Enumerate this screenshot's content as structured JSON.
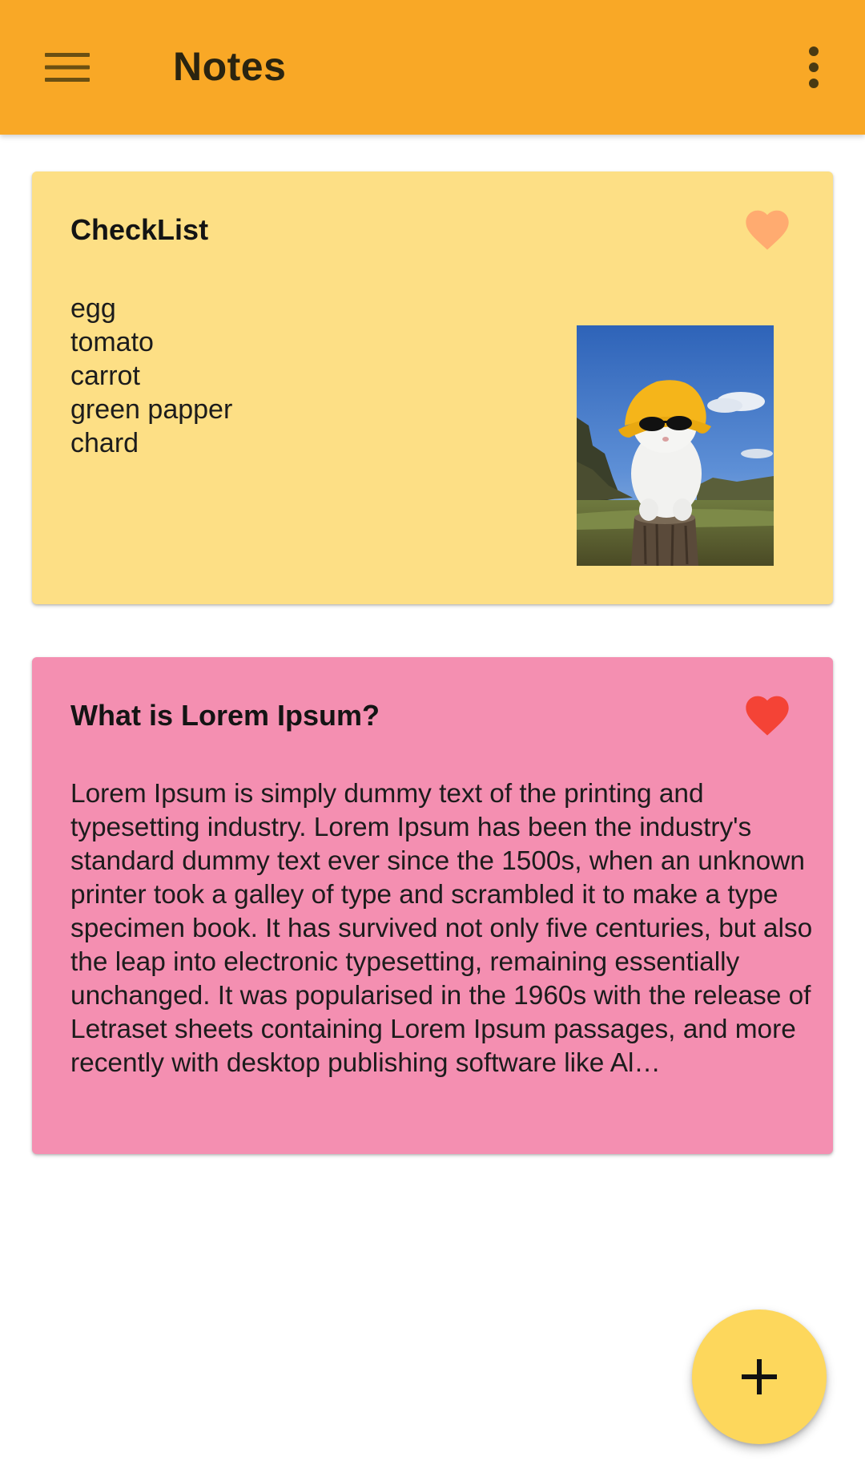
{
  "app_bar": {
    "title": "Notes",
    "menu_icon": "hamburger-menu-icon",
    "overflow_icon": "more-vert-icon",
    "color": "#f9a826"
  },
  "notes": [
    {
      "title": "CheckList",
      "favorite": true,
      "favorite_color": "#ffab70",
      "background": "#fddf85",
      "items": [
        "egg",
        "tomato",
        "carrot",
        "green papper",
        "chard"
      ],
      "has_image": true,
      "image_icon": "cat-photo-thumbnail"
    },
    {
      "title": "What is Lorem Ipsum?",
      "favorite": true,
      "favorite_color": "#f44336",
      "background": "#f48fb1",
      "body": "Lorem Ipsum is simply dummy text of the printing and typesetting industry. Lorem Ipsum has been the industry's standard dummy text ever since the 1500s, when an unknown printer took a galley of type and scrambled it to make a type specimen book. It has survived not only five centuries, but also the leap into electronic typesetting, remaining essentially unchanged. It was popularised in the 1960s with the release of Letraset sheets containing Lorem Ipsum passages, and more recently with desktop publishing software like Al…"
    }
  ],
  "fab": {
    "icon": "add-icon",
    "color": "#fdd75c"
  }
}
